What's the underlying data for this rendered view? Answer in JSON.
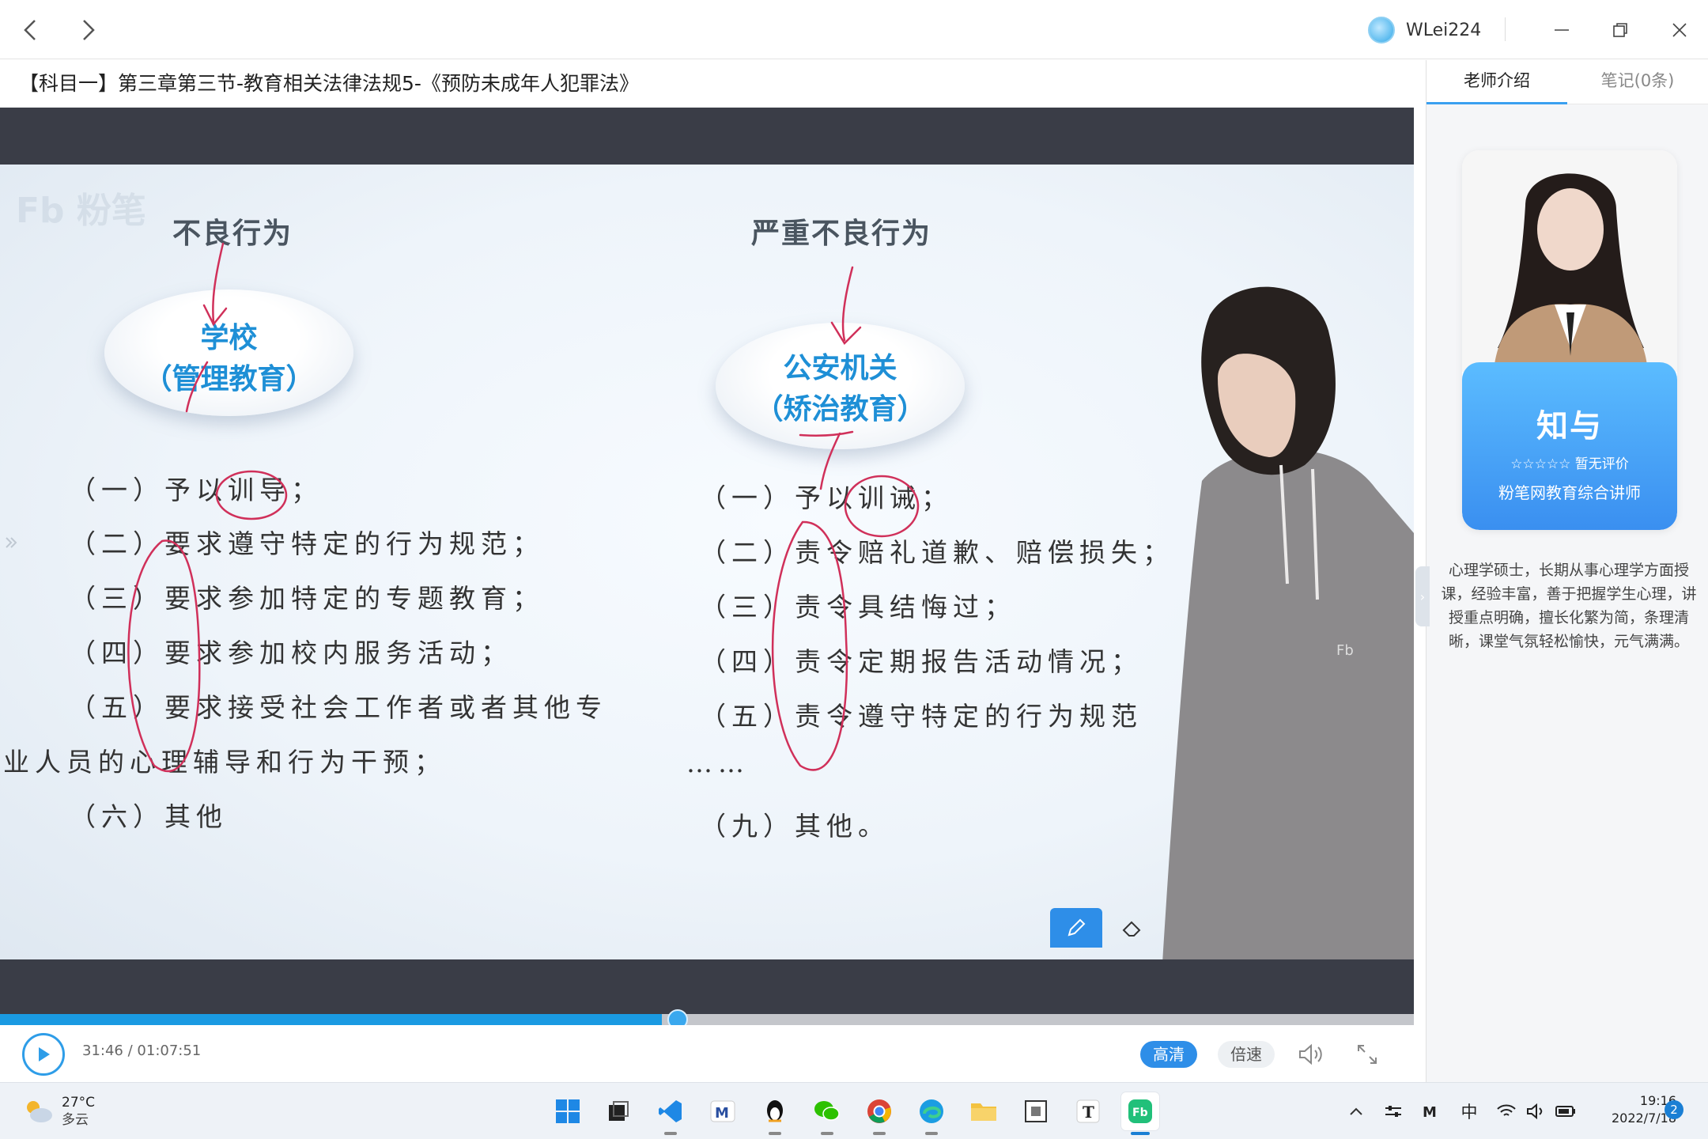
{
  "window": {
    "username": "WLei224",
    "course_title": "【科目一】第三章第三节-教育相关法律法规5-《预防未成年人犯罪法》"
  },
  "right_panel": {
    "tabs": [
      "老师介绍",
      "笔记(0条)"
    ],
    "active_tab": 0,
    "teacher": {
      "name": "知与",
      "stars": "☆☆☆☆☆",
      "rating_text": "暂无评价",
      "role": "粉笔网教育综合讲师",
      "description": "心理学硕士，长期从事心理学方面授课，经验丰富，善于把握学生心理，讲授重点明确，擅长化繁为简，条理清晰，课堂气氛轻松愉快，元气满满。"
    }
  },
  "slide": {
    "watermark": "Fb 粉笔",
    "left": {
      "heading": "不良行为",
      "box_line1": "学校",
      "box_line2": "（管理教育）",
      "items": [
        "（一）予以训导；",
        "（二）要求遵守特定的行为规范；",
        "（三）要求参加特定的专题教育；",
        "（四）要求参加校内服务活动；",
        "（五）要求接受社会工作者或者其他专",
        "业人员的心理辅导和行为干预；",
        "（六）其他"
      ]
    },
    "right": {
      "heading": "严重不良行为",
      "box_line1": "公安机关",
      "box_line2": "（矫治教育）",
      "items": [
        "（一）予以训诫；",
        "（二）责令赔礼道歉、赔偿损失；",
        "（三）责令具结悔过；",
        "（四）责令定期报告活动情况；",
        "（五）责令遵守特定的行为规范",
        "……",
        "（九）其他。"
      ]
    }
  },
  "player": {
    "current_time": "31:46",
    "separator": "/",
    "total_time": "01:07:51",
    "progress_fraction": 0.468,
    "quality_label": "高清",
    "speed_label": "倍速",
    "accent_color": "#2e8ee8"
  },
  "taskbar": {
    "weather_temp": "27°C",
    "weather_cond": "多云",
    "apps": [
      "windows-start",
      "task-view",
      "vscode",
      "mail-m",
      "qq",
      "wechat",
      "chrome",
      "edge",
      "file-explorer",
      "notepad-app",
      "typora",
      "fenbi"
    ],
    "ime": "中",
    "time": "19:16",
    "date": "2022/7/18",
    "notification_count": "2"
  }
}
